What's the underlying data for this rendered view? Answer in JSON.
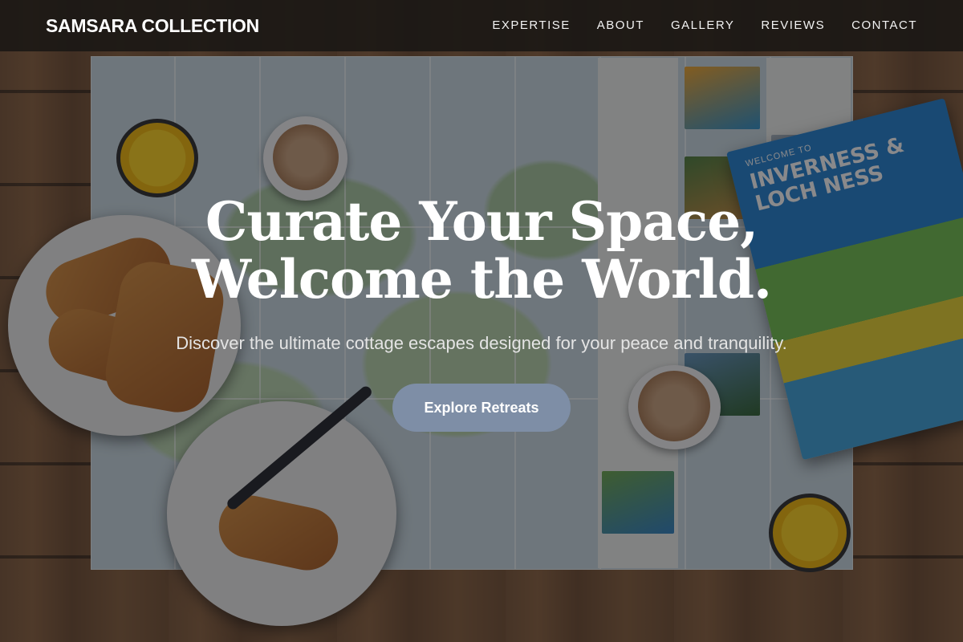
{
  "brand": {
    "name": "SAMSARA COLLECTION"
  },
  "nav": {
    "links": [
      {
        "label": "EXPERTISE"
      },
      {
        "label": "ABOUT"
      },
      {
        "label": "GALLERY"
      },
      {
        "label": "REVIEWS"
      },
      {
        "label": "CONTACT"
      }
    ]
  },
  "hero": {
    "title_line1": "Curate Your Space,",
    "title_line2": "Welcome the World.",
    "subtitle": "Discover the ultimate cottage escapes designed for your peace and tranquility.",
    "cta_label": "Explore Retreats"
  },
  "background": {
    "guide_header": "WELCOME TO",
    "guide_title": "INVERNESS & LOCH NESS"
  },
  "colors": {
    "nav_bg": "#181614",
    "cta_bg": "#7e8ea6",
    "text": "#ffffff"
  }
}
